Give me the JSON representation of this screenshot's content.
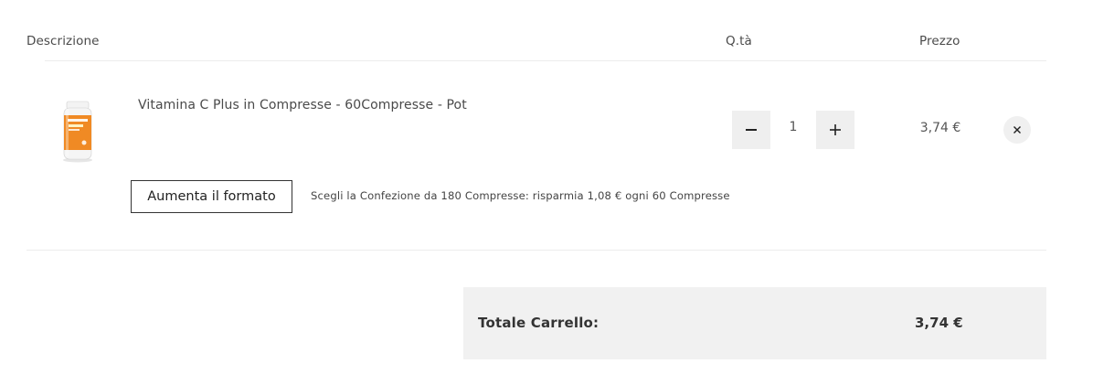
{
  "table_header": {
    "description": "Descrizione",
    "quantity": "Q.tà",
    "price": "Prezzo"
  },
  "cart_item": {
    "name": "Vitamina C Plus in Compresse - 60Compresse - Pot",
    "quantity": "1",
    "price": "3,74 €",
    "image_icon": "vitamin-bottle-icon",
    "upsize_button_label": "Aumenta il formato",
    "upsize_message": "Scegli la Confezione da 180 Compresse: risparmia 1,08 € ogni 60 Compresse"
  },
  "cart_total": {
    "label": "Totale Carrello:",
    "value": "3,74 €"
  },
  "colors": {
    "accent_orange": "#f08a24",
    "button_bg": "#efefef",
    "total_bg": "#f1f1f1"
  }
}
